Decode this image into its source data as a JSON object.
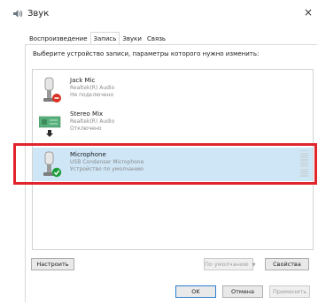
{
  "window": {
    "title": "Звук",
    "icon": "speaker-icon",
    "close_icon": "close-icon",
    "close_glyph": "×"
  },
  "tabs": [
    {
      "label": "Воспроизведение",
      "active": false
    },
    {
      "label": "Запись",
      "active": true
    },
    {
      "label": "Звуки",
      "active": false
    },
    {
      "label": "Связь",
      "active": false
    }
  ],
  "instruction": "Выберите устройство записи, параметры которого нужно изменить:",
  "devices": [
    {
      "name": "Jack Mic",
      "driver": "Realtek(R) Audio",
      "status": "Не подключено",
      "icon": "microphone-icon",
      "badge": "disconnected-badge-icon",
      "selected": false
    },
    {
      "name": "Stereo Mix",
      "driver": "Realtek(R) Audio",
      "status": "Отключено",
      "icon": "soundcard-icon",
      "badge": "disabled-arrow-badge-icon",
      "selected": false
    },
    {
      "name": "Microphone",
      "driver": "USB Condenser Microphone",
      "status": "Устройство по умолчанию",
      "icon": "microphone-icon",
      "badge": "default-check-badge-icon",
      "selected": true
    }
  ],
  "buttons": {
    "configure": "Настроить",
    "set_default": "По умолчанию",
    "properties": "Свойства",
    "ok": "OK",
    "cancel": "Отмена",
    "apply": "Применить"
  },
  "colors": {
    "selection": "#cfe6f7",
    "highlight": "#e0262c",
    "default_check": "#1e9e3b",
    "disconnected": "#d93025"
  }
}
